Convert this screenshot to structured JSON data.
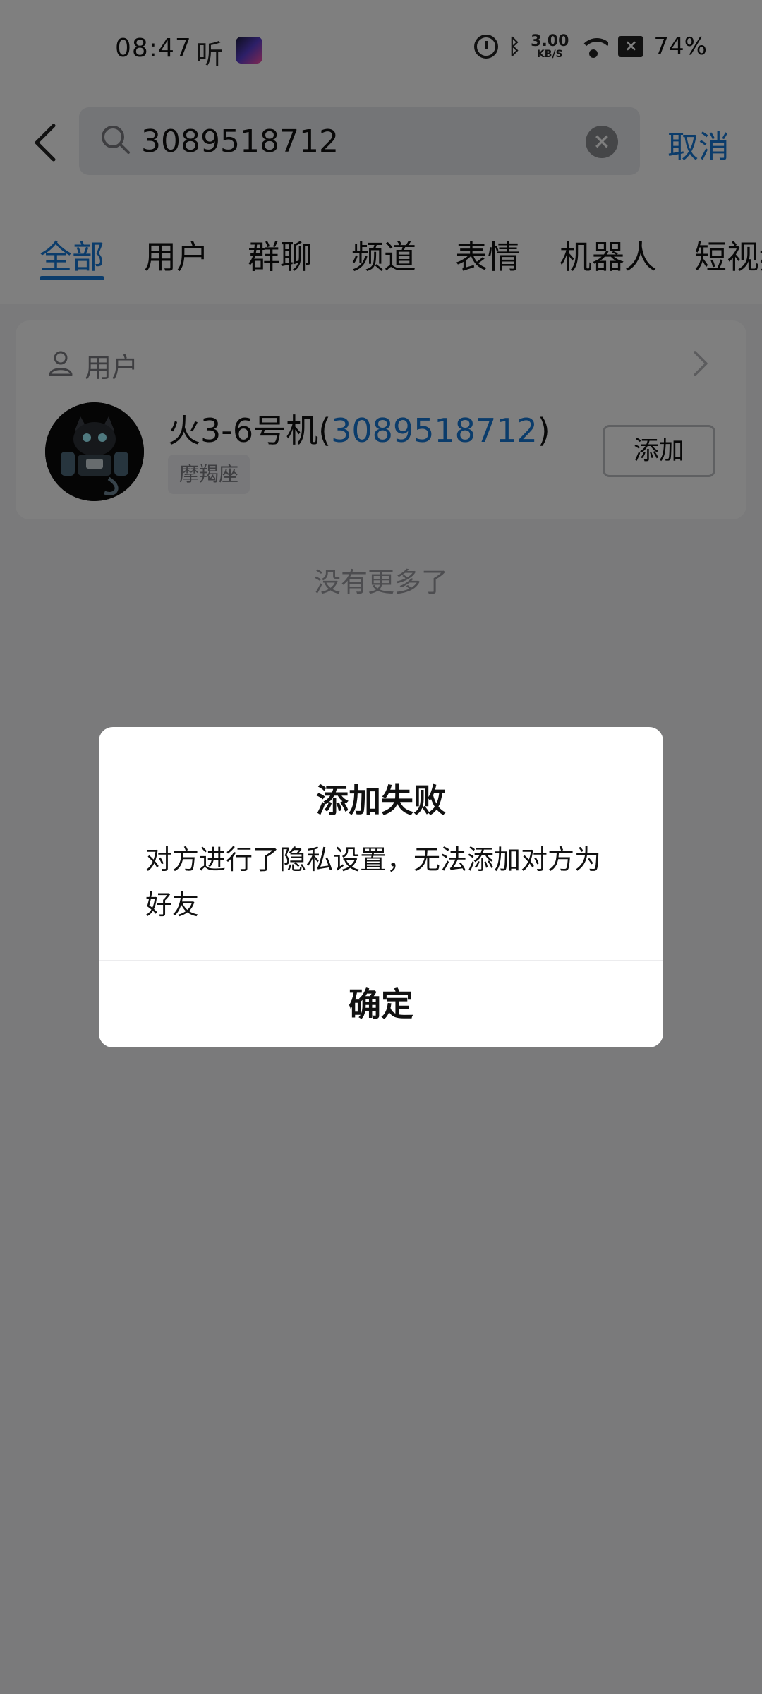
{
  "status_bar": {
    "time": "08:47",
    "ting_label": "听",
    "net_speed": "3.00",
    "net_unit": "KB/S",
    "battery": "74%"
  },
  "search": {
    "query": "3089518712",
    "cancel_label": "取消"
  },
  "tabs": [
    "全部",
    "用户",
    "群聊",
    "频道",
    "表情",
    "机器人",
    "短视频"
  ],
  "active_tab": "全部",
  "results": {
    "section_title": "用户",
    "user": {
      "name_prefix": "火3-6号机(",
      "name_highlight": "3089518712",
      "name_suffix": ")",
      "tag": "摩羯座",
      "add_label": "添加"
    },
    "no_more": "没有更多了"
  },
  "dialog": {
    "title": "添加失败",
    "message": "对方进行了隐私设置，无法添加对方为好友",
    "confirm_label": "确定"
  },
  "colors": {
    "accent": "#1679d6",
    "overlay": "rgba(0,0,0,0.5)"
  }
}
